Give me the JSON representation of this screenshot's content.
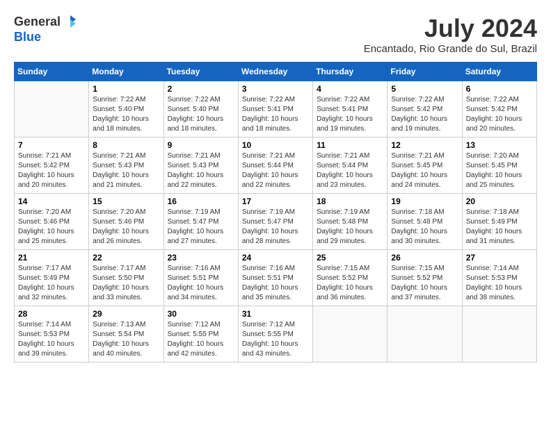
{
  "header": {
    "logo_general": "General",
    "logo_blue": "Blue",
    "month_year": "July 2024",
    "location": "Encantado, Rio Grande do Sul, Brazil"
  },
  "days_of_week": [
    "Sunday",
    "Monday",
    "Tuesday",
    "Wednesday",
    "Thursday",
    "Friday",
    "Saturday"
  ],
  "weeks": [
    [
      {
        "day": "",
        "sunrise": "",
        "sunset": "",
        "daylight": "",
        "empty": true
      },
      {
        "day": "1",
        "sunrise": "7:22 AM",
        "sunset": "5:40 PM",
        "daylight": "10 hours and 18 minutes."
      },
      {
        "day": "2",
        "sunrise": "7:22 AM",
        "sunset": "5:40 PM",
        "daylight": "10 hours and 18 minutes."
      },
      {
        "day": "3",
        "sunrise": "7:22 AM",
        "sunset": "5:41 PM",
        "daylight": "10 hours and 18 minutes."
      },
      {
        "day": "4",
        "sunrise": "7:22 AM",
        "sunset": "5:41 PM",
        "daylight": "10 hours and 19 minutes."
      },
      {
        "day": "5",
        "sunrise": "7:22 AM",
        "sunset": "5:42 PM",
        "daylight": "10 hours and 19 minutes."
      },
      {
        "day": "6",
        "sunrise": "7:22 AM",
        "sunset": "5:42 PM",
        "daylight": "10 hours and 20 minutes."
      }
    ],
    [
      {
        "day": "7",
        "sunrise": "7:21 AM",
        "sunset": "5:42 PM",
        "daylight": "10 hours and 20 minutes."
      },
      {
        "day": "8",
        "sunrise": "7:21 AM",
        "sunset": "5:43 PM",
        "daylight": "10 hours and 21 minutes."
      },
      {
        "day": "9",
        "sunrise": "7:21 AM",
        "sunset": "5:43 PM",
        "daylight": "10 hours and 22 minutes."
      },
      {
        "day": "10",
        "sunrise": "7:21 AM",
        "sunset": "5:44 PM",
        "daylight": "10 hours and 22 minutes."
      },
      {
        "day": "11",
        "sunrise": "7:21 AM",
        "sunset": "5:44 PM",
        "daylight": "10 hours and 23 minutes."
      },
      {
        "day": "12",
        "sunrise": "7:21 AM",
        "sunset": "5:45 PM",
        "daylight": "10 hours and 24 minutes."
      },
      {
        "day": "13",
        "sunrise": "7:20 AM",
        "sunset": "5:45 PM",
        "daylight": "10 hours and 25 minutes."
      }
    ],
    [
      {
        "day": "14",
        "sunrise": "7:20 AM",
        "sunset": "5:46 PM",
        "daylight": "10 hours and 25 minutes."
      },
      {
        "day": "15",
        "sunrise": "7:20 AM",
        "sunset": "5:46 PM",
        "daylight": "10 hours and 26 minutes."
      },
      {
        "day": "16",
        "sunrise": "7:19 AM",
        "sunset": "5:47 PM",
        "daylight": "10 hours and 27 minutes."
      },
      {
        "day": "17",
        "sunrise": "7:19 AM",
        "sunset": "5:47 PM",
        "daylight": "10 hours and 28 minutes."
      },
      {
        "day": "18",
        "sunrise": "7:19 AM",
        "sunset": "5:48 PM",
        "daylight": "10 hours and 29 minutes."
      },
      {
        "day": "19",
        "sunrise": "7:18 AM",
        "sunset": "5:48 PM",
        "daylight": "10 hours and 30 minutes."
      },
      {
        "day": "20",
        "sunrise": "7:18 AM",
        "sunset": "5:49 PM",
        "daylight": "10 hours and 31 minutes."
      }
    ],
    [
      {
        "day": "21",
        "sunrise": "7:17 AM",
        "sunset": "5:49 PM",
        "daylight": "10 hours and 32 minutes."
      },
      {
        "day": "22",
        "sunrise": "7:17 AM",
        "sunset": "5:50 PM",
        "daylight": "10 hours and 33 minutes."
      },
      {
        "day": "23",
        "sunrise": "7:16 AM",
        "sunset": "5:51 PM",
        "daylight": "10 hours and 34 minutes."
      },
      {
        "day": "24",
        "sunrise": "7:16 AM",
        "sunset": "5:51 PM",
        "daylight": "10 hours and 35 minutes."
      },
      {
        "day": "25",
        "sunrise": "7:15 AM",
        "sunset": "5:52 PM",
        "daylight": "10 hours and 36 minutes."
      },
      {
        "day": "26",
        "sunrise": "7:15 AM",
        "sunset": "5:52 PM",
        "daylight": "10 hours and 37 minutes."
      },
      {
        "day": "27",
        "sunrise": "7:14 AM",
        "sunset": "5:53 PM",
        "daylight": "10 hours and 38 minutes."
      }
    ],
    [
      {
        "day": "28",
        "sunrise": "7:14 AM",
        "sunset": "5:53 PM",
        "daylight": "10 hours and 39 minutes."
      },
      {
        "day": "29",
        "sunrise": "7:13 AM",
        "sunset": "5:54 PM",
        "daylight": "10 hours and 40 minutes."
      },
      {
        "day": "30",
        "sunrise": "7:12 AM",
        "sunset": "5:55 PM",
        "daylight": "10 hours and 42 minutes."
      },
      {
        "day": "31",
        "sunrise": "7:12 AM",
        "sunset": "5:55 PM",
        "daylight": "10 hours and 43 minutes."
      },
      {
        "day": "",
        "sunrise": "",
        "sunset": "",
        "daylight": "",
        "empty": true
      },
      {
        "day": "",
        "sunrise": "",
        "sunset": "",
        "daylight": "",
        "empty": true
      },
      {
        "day": "",
        "sunrise": "",
        "sunset": "",
        "daylight": "",
        "empty": true
      }
    ]
  ],
  "labels": {
    "sunrise_prefix": "Sunrise: ",
    "sunset_prefix": "Sunset: ",
    "daylight_prefix": "Daylight: "
  }
}
